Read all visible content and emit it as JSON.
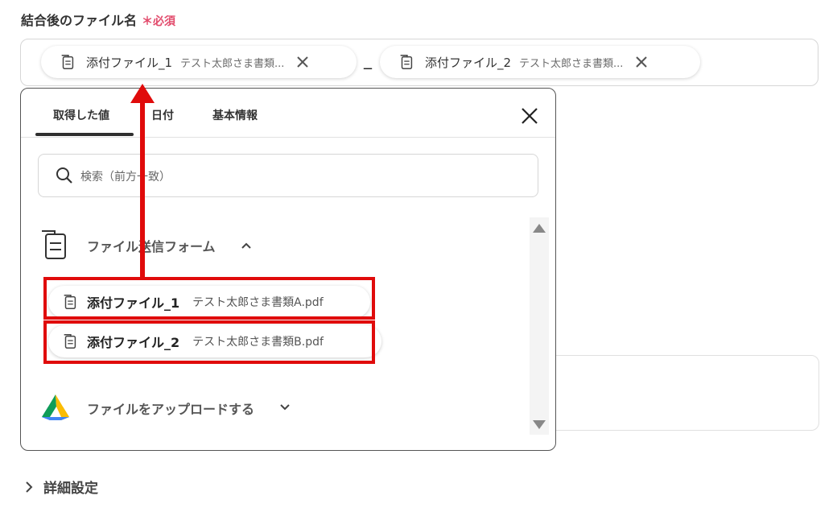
{
  "field": {
    "label": "結合後のファイル名",
    "required": "＊必須"
  },
  "chips": [
    {
      "name": "添付ファイル_1",
      "value": "テスト太郎さま書類..."
    },
    {
      "name": "添付ファイル_2",
      "value": "テスト太郎さま書類..."
    }
  ],
  "separator": "_",
  "popup": {
    "tabs": [
      "取得した値",
      "日付",
      "基本情報"
    ],
    "search_placeholder": "検索（前方一致）",
    "group1": {
      "title": "ファイル送信フォーム",
      "items": [
        {
          "name": "添付ファイル_1",
          "value": "テスト太郎さま書類A.pdf"
        },
        {
          "name": "添付ファイル_2",
          "value": "テスト太郎さま書類B.pdf"
        }
      ]
    },
    "group2": {
      "title": "ファイルをアップロードする"
    }
  },
  "details": {
    "label": "詳細設定"
  },
  "colors": {
    "accent_red": "#e00b0b",
    "required_pink": "#e24b6c"
  }
}
